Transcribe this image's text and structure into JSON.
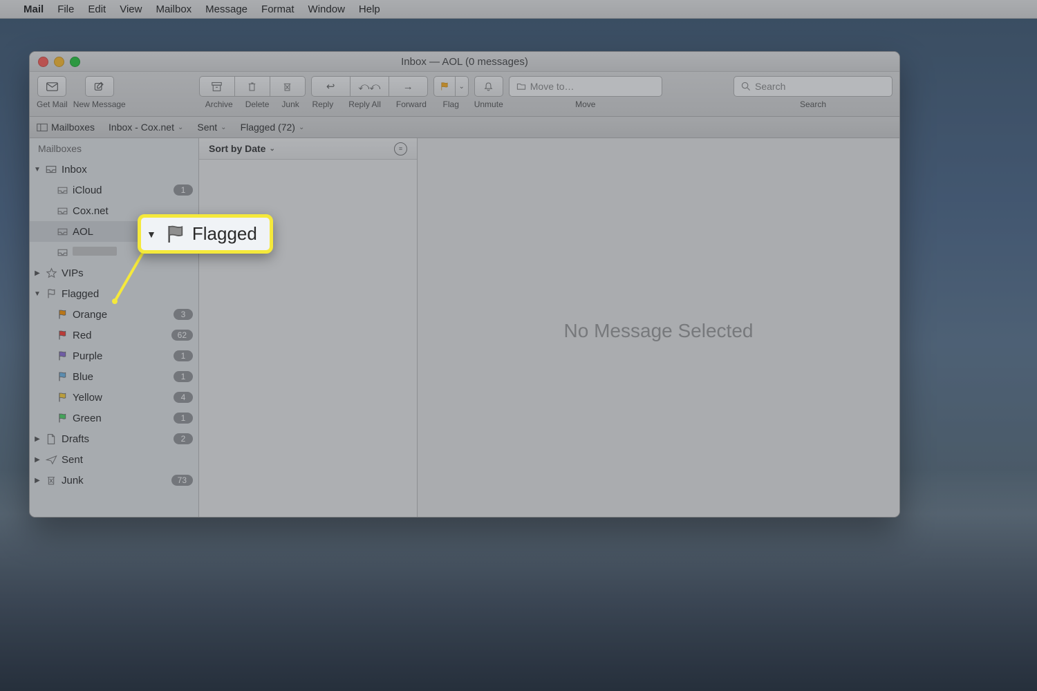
{
  "menubar": {
    "app": "Mail",
    "items": [
      "File",
      "Edit",
      "View",
      "Mailbox",
      "Message",
      "Format",
      "Window",
      "Help"
    ]
  },
  "window_title": "Inbox — AOL (0 messages)",
  "toolbar": {
    "get_mail": "Get Mail",
    "new_message": "New Message",
    "archive": "Archive",
    "delete": "Delete",
    "junk": "Junk",
    "reply": "Reply",
    "reply_all": "Reply All",
    "forward": "Forward",
    "flag": "Flag",
    "unmute": "Unmute",
    "move_placeholder": "Move to…",
    "move_label": "Move",
    "search_placeholder": "Search",
    "search_label": "Search"
  },
  "favorites": {
    "mailboxes": "Mailboxes",
    "items": [
      {
        "label": "Inbox - Cox.net"
      },
      {
        "label": "Sent"
      },
      {
        "label": "Flagged (72)"
      }
    ]
  },
  "sidebar": {
    "header": "Mailboxes",
    "inbox": {
      "label": "Inbox",
      "accounts": [
        {
          "label": "iCloud",
          "count": "1"
        },
        {
          "label": "Cox.net"
        },
        {
          "label": "AOL",
          "selected": true
        },
        {
          "label": ""
        }
      ]
    },
    "vips": "VIPs",
    "flagged": {
      "label": "Flagged",
      "items": [
        {
          "label": "Orange",
          "count": "3",
          "color": "#ff9500"
        },
        {
          "label": "Red",
          "count": "62",
          "color": "#ff3b30"
        },
        {
          "label": "Purple",
          "count": "1",
          "color": "#8e6dd7"
        },
        {
          "label": "Blue",
          "count": "1",
          "color": "#6fb7e8"
        },
        {
          "label": "Yellow",
          "count": "4",
          "color": "#ffd23a"
        },
        {
          "label": "Green",
          "count": "1",
          "color": "#4cd964"
        }
      ]
    },
    "drafts": {
      "label": "Drafts",
      "count": "2"
    },
    "sent": {
      "label": "Sent"
    },
    "junk": {
      "label": "Junk",
      "count": "73"
    }
  },
  "list": {
    "sort": "Sort by Date"
  },
  "content": {
    "placeholder": "No Message Selected"
  },
  "callout": {
    "label": "Flagged"
  }
}
